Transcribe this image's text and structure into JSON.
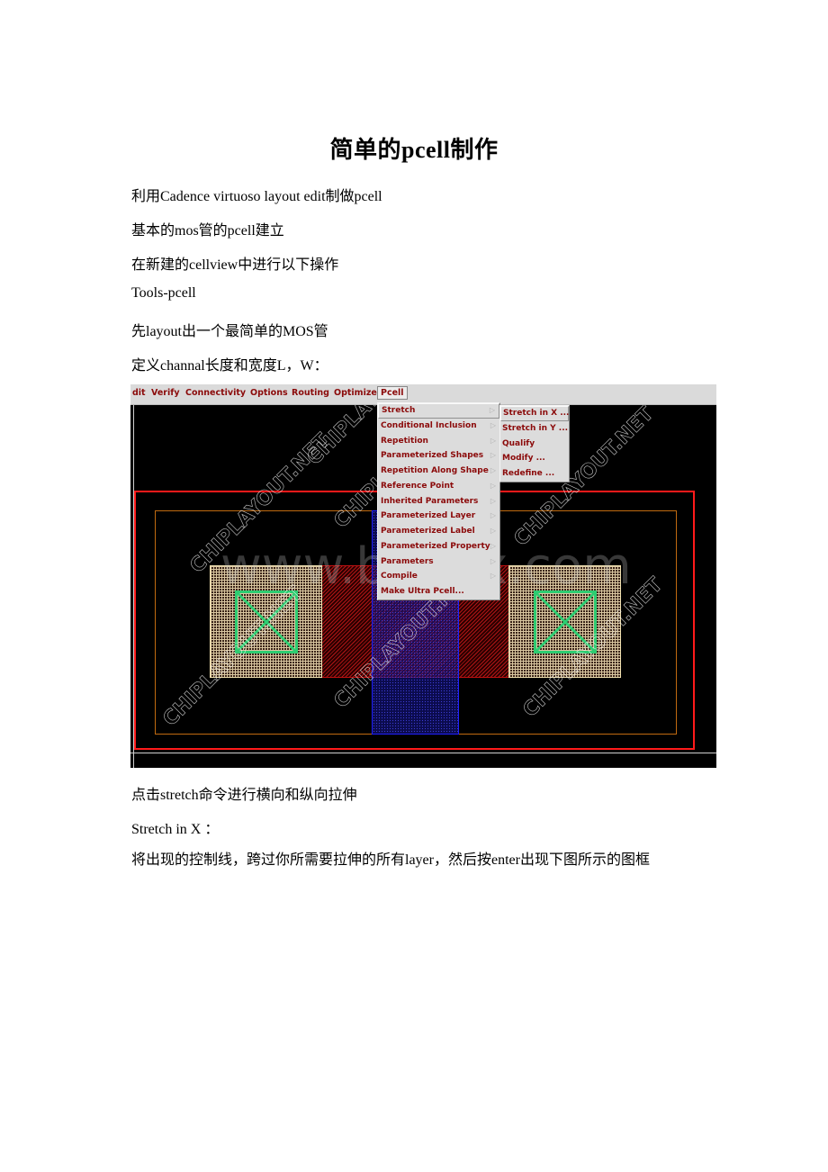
{
  "document": {
    "title": "简单的pcell制作",
    "paragraphs_before_figure": [
      "利用Cadence virtuoso layout edit制做pcell",
      "基本的mos管的pcell建立",
      "在新建的cellview中进行以下操作",
      "Tools-pcell",
      "先layout出一个最简单的MOS管",
      "定义channal长度和宽度L，W："
    ],
    "paragraphs_after_figure": [
      "点击stretch命令进行横向和纵向拉伸",
      "Stretch in X ：",
      "将出现的控制线，跨过你所需要拉伸的所有layer，然后按enter出现下图所示的图框"
    ]
  },
  "screenshot": {
    "menubar": [
      "dit",
      "Verify",
      "Connectivity",
      "Options",
      "Routing",
      "Optimize",
      "Pcell"
    ],
    "active_menu": "Pcell",
    "pcell_menu": [
      {
        "label": "Stretch",
        "submenu": true,
        "highlighted": true
      },
      {
        "label": "Conditional Inclusion",
        "submenu": true
      },
      {
        "label": "Repetition",
        "submenu": true
      },
      {
        "label": "Parameterized Shapes",
        "submenu": true
      },
      {
        "label": "Repetition Along Shape",
        "submenu": true
      },
      {
        "label": "Reference Point",
        "submenu": true
      },
      {
        "label": "Inherited Parameters",
        "submenu": true
      },
      {
        "label": "Parameterized Layer",
        "submenu": true
      },
      {
        "label": "Parameterized Label",
        "submenu": true
      },
      {
        "label": "Parameterized Property",
        "submenu": true
      },
      {
        "label": "Parameters",
        "submenu": true
      },
      {
        "label": "Compile",
        "submenu": true
      },
      {
        "label": "Make Ultra Pcell...",
        "submenu": false
      }
    ],
    "stretch_submenu": [
      {
        "label": "Stretch in X ...",
        "highlighted": true
      },
      {
        "label": "Stretch in Y ..."
      },
      {
        "label": "Qualify"
      },
      {
        "label": "Modify ..."
      },
      {
        "label": "Redefine ..."
      }
    ],
    "arrow_glyph": "▷",
    "watermarks": [
      "CHIPLAYOUT.NET",
      "www.bdocx.com"
    ],
    "layout_layers": {
      "outer_boundary": "#ff1a1a",
      "well": "#c06a10",
      "poly": "#b01515",
      "diffusion": "#2020ff",
      "contact_metal": "#d9c6a0",
      "via": "#2ecc71"
    }
  }
}
